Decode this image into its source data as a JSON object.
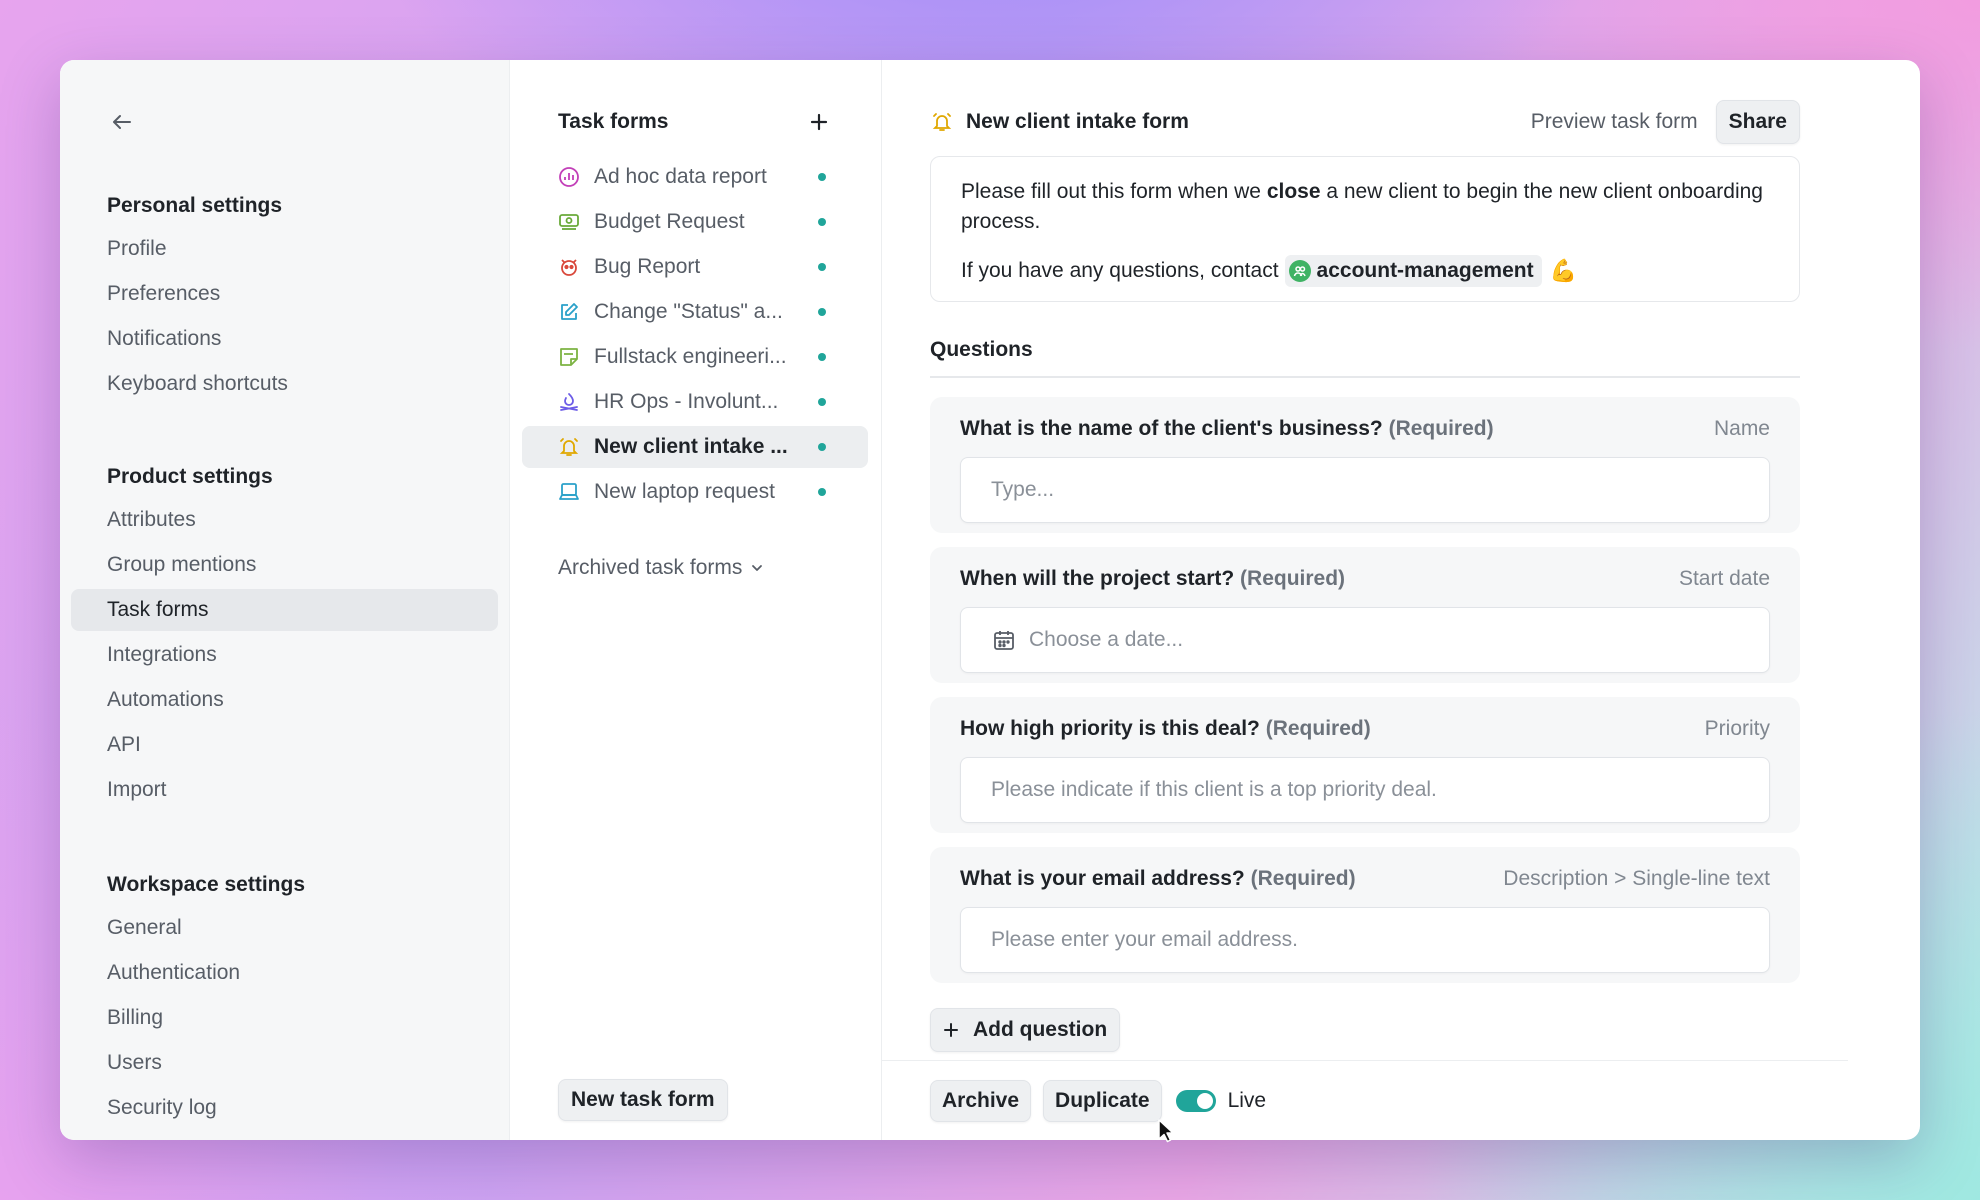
{
  "settings": {
    "back_label": "Back",
    "personal": {
      "title": "Personal settings",
      "items": [
        "Profile",
        "Preferences",
        "Notifications",
        "Keyboard shortcuts"
      ]
    },
    "product": {
      "title": "Product settings",
      "items": [
        "Attributes",
        "Group mentions",
        "Task forms",
        "Integrations",
        "Automations",
        "API",
        "Import"
      ],
      "active": "Task forms"
    },
    "workspace": {
      "title": "Workspace settings",
      "items": [
        "General",
        "Authentication",
        "Billing",
        "Users",
        "Security log"
      ]
    }
  },
  "forms_list": {
    "title": "Task forms",
    "items": [
      {
        "label": "Ad hoc data report",
        "icon": "chart-icon",
        "color": "#c23fb8"
      },
      {
        "label": "Budget Request",
        "icon": "money-icon",
        "color": "#6aaa3a"
      },
      {
        "label": "Bug Report",
        "icon": "bug-icon",
        "color": "#d9483b"
      },
      {
        "label": "Change \"Status\" a...",
        "icon": "edit-icon",
        "color": "#2aa1c9"
      },
      {
        "label": "Fullstack engineeri...",
        "icon": "note-icon",
        "color": "#7cb342"
      },
      {
        "label": "HR Ops - Involunt...",
        "icon": "fire-icon",
        "color": "#6c5ce7"
      },
      {
        "label": "New client intake ...",
        "icon": "bell-icon",
        "color": "#e0a800"
      },
      {
        "label": "New laptop request",
        "icon": "laptop-icon",
        "color": "#2aa1c9"
      }
    ],
    "active_index": 6,
    "status_color": "#20a59a",
    "archived_label": "Archived task forms",
    "new_button": "New task form"
  },
  "main": {
    "title": "New client intake form",
    "preview_label": "Preview task form",
    "share_label": "Share",
    "description": {
      "line1_pre": "Please fill out this form when we ",
      "line1_bold": "close",
      "line1_post": " a new client to begin the new client onboarding process.",
      "line2_pre": "If you have any questions, contact",
      "mention": "account-management",
      "emoji": "💪"
    },
    "questions_title": "Questions",
    "questions": [
      {
        "label": "What is the name of the client's business?",
        "required": "(Required)",
        "type": "Name",
        "placeholder": "Type..."
      },
      {
        "label": "When will the project start?",
        "required": "(Required)",
        "type": "Start date",
        "placeholder": "Choose a date..."
      },
      {
        "label": "How high priority is this deal?",
        "required": "(Required)",
        "type": "Priority",
        "placeholder": "Please indicate if this client is a top priority deal."
      },
      {
        "label": "What is your email address?",
        "required": "(Required)",
        "type": "Description > Single-line text",
        "placeholder": "Please enter your email address."
      }
    ],
    "add_question": "Add question",
    "footer": {
      "archive": "Archive",
      "duplicate": "Duplicate",
      "live": "Live"
    }
  },
  "colors": {
    "accent": "#20a59a",
    "active_bg": "#e6e8eb"
  }
}
